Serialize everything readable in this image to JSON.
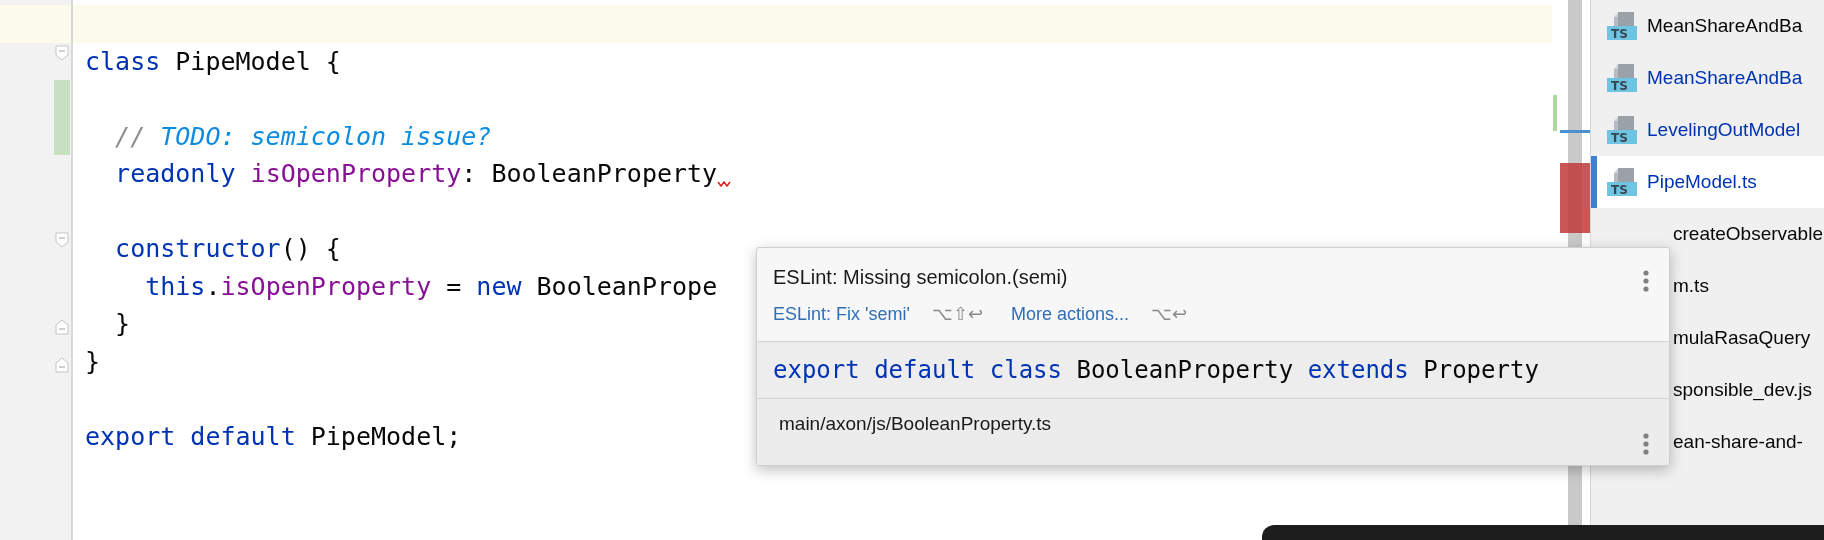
{
  "editor": {
    "lines": [
      {
        "kind": "blank",
        "current": true
      },
      {
        "kind": "code",
        "fold_start": true,
        "tokens": [
          {
            "text": "class",
            "kind": "keyword"
          },
          {
            "text": " PipeModel {",
            "kind": "plain"
          }
        ]
      },
      {
        "kind": "blank",
        "changed": true
      },
      {
        "kind": "code",
        "changed": true,
        "tokens": [
          {
            "text": "  // ",
            "kind": "comment-mark"
          },
          {
            "text": "TODO: semicolon issue?",
            "kind": "comment"
          }
        ]
      },
      {
        "kind": "code",
        "error": true,
        "tokens": [
          {
            "text": "  readonly ",
            "kind": "keyword"
          },
          {
            "text": "isOpenProperty",
            "kind": "field"
          },
          {
            "text": ": BooleanProperty",
            "kind": "plain"
          }
        ]
      },
      {
        "kind": "blank"
      },
      {
        "kind": "code",
        "fold_start": true,
        "tokens": [
          {
            "text": "  constructor",
            "kind": "keyword"
          },
          {
            "text": "() {",
            "kind": "plain"
          }
        ]
      },
      {
        "kind": "code",
        "tokens": [
          {
            "text": "    this",
            "kind": "keyword"
          },
          {
            "text": ".",
            "kind": "plain"
          },
          {
            "text": "isOpenProperty",
            "kind": "field"
          },
          {
            "text": " = ",
            "kind": "plain"
          },
          {
            "text": "new",
            "kind": "keyword"
          },
          {
            "text": " BooleanPrope",
            "kind": "plain"
          }
        ]
      },
      {
        "kind": "code",
        "fold_end": true,
        "tokens": [
          {
            "text": "  }",
            "kind": "plain"
          }
        ]
      },
      {
        "kind": "code",
        "fold_end": true,
        "tokens": [
          {
            "text": "}",
            "kind": "plain"
          }
        ]
      },
      {
        "kind": "blank"
      },
      {
        "kind": "code",
        "tokens": [
          {
            "text": "export default",
            "kind": "keyword"
          },
          {
            "text": " PipeModel;",
            "kind": "plain"
          }
        ]
      }
    ]
  },
  "popup": {
    "message": "ESLint: Missing semicolon.(semi)",
    "actions": [
      {
        "label": "ESLint: Fix 'semi'",
        "shortcut": "⌥⇧↩"
      },
      {
        "label": "More actions...",
        "shortcut": "⌥↩"
      }
    ],
    "declaration": [
      {
        "text": "export default class",
        "kind": "keyword"
      },
      {
        "text": " BooleanProperty ",
        "kind": "plain"
      },
      {
        "text": "extends",
        "kind": "keyword"
      },
      {
        "text": " Property",
        "kind": "plain"
      }
    ],
    "path": "main/axon/js/BooleanProperty.ts"
  },
  "files": [
    {
      "name": "MeanShareAndBa",
      "icon_label": "TS",
      "selected": false,
      "color": "#080808"
    },
    {
      "name": "MeanShareAndBa",
      "icon_label": "TS",
      "selected": false,
      "color": "#0033b3"
    },
    {
      "name": "LevelingOutModel",
      "icon_label": "TS",
      "selected": false,
      "color": "#0033b3"
    },
    {
      "name": "PipeModel.ts",
      "icon_label": "TS",
      "selected": true,
      "color": "#0033b3"
    },
    {
      "name": "createObservable",
      "selected": false,
      "color": "#080808"
    },
    {
      "name": "m.ts",
      "selected": false,
      "color": "#080808"
    },
    {
      "name": "mulaRasaQuery",
      "selected": false,
      "color": "#080808"
    },
    {
      "name": "sponsible_dev.js",
      "selected": false,
      "color": "#080808"
    },
    {
      "name": "ean-share-and-",
      "selected": false,
      "color": "#080808"
    }
  ]
}
